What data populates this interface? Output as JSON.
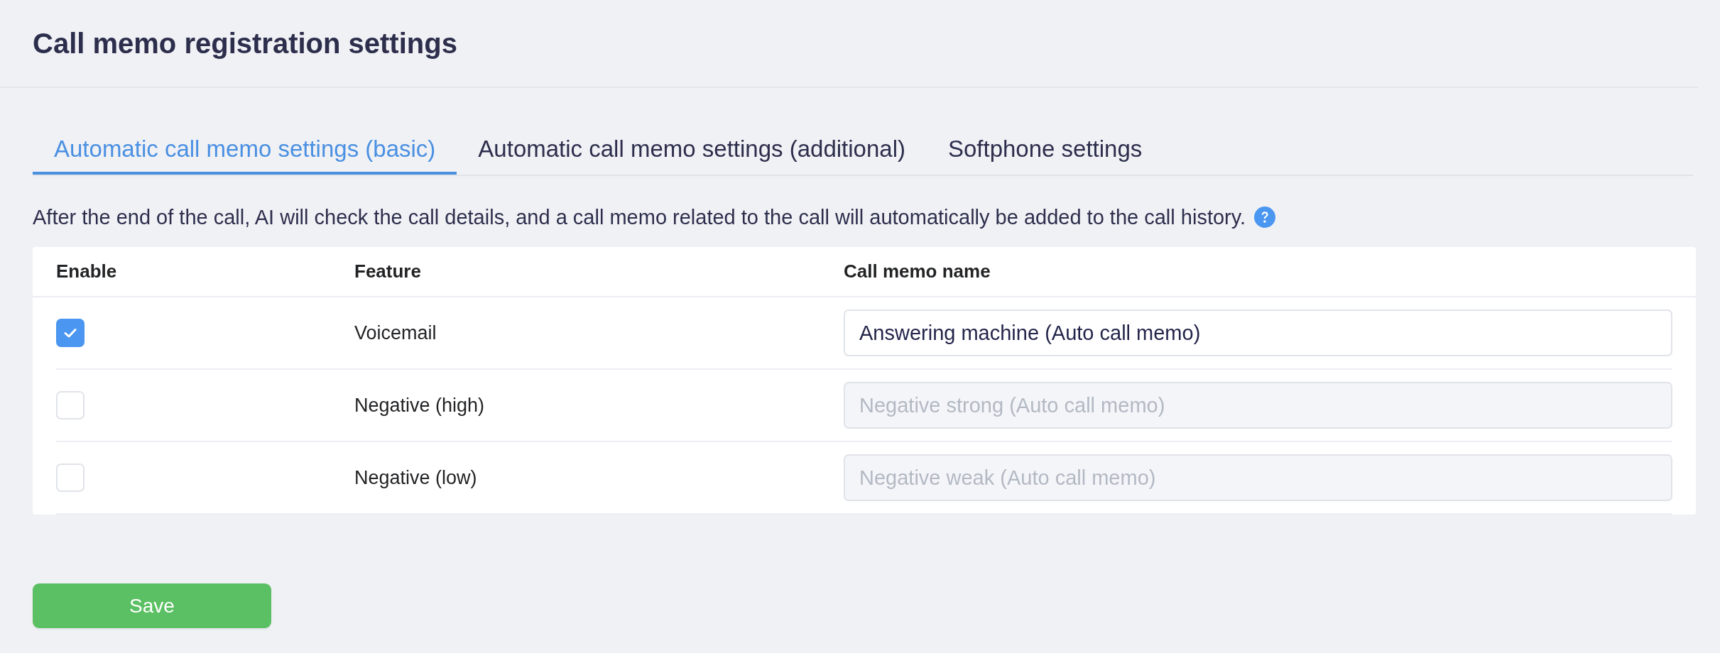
{
  "page": {
    "title": "Call memo registration settings"
  },
  "tabs": [
    {
      "label": "Automatic call memo settings (basic)",
      "selected": true
    },
    {
      "label": "Automatic call memo settings (additional)",
      "selected": false
    },
    {
      "label": "Softphone settings",
      "selected": false
    }
  ],
  "description": "After the end of the call, AI will check the call details, and a call memo related to the call will automatically be added to the call history.",
  "table": {
    "columns": [
      "Enable",
      "Feature",
      "Call memo name"
    ],
    "rows": [
      {
        "enabled": true,
        "feature": "Voicemail",
        "memo_name": {
          "value": "Answering machine (Auto call memo)",
          "disabled": false
        }
      },
      {
        "enabled": false,
        "feature": "Negative (high)",
        "memo_name": {
          "value": "Negative strong (Auto call memo)",
          "disabled": true
        }
      },
      {
        "enabled": false,
        "feature": "Negative (low)",
        "memo_name": {
          "value": "Negative weak (Auto call memo)",
          "disabled": true
        }
      }
    ]
  },
  "save_button": {
    "label": "Save"
  }
}
